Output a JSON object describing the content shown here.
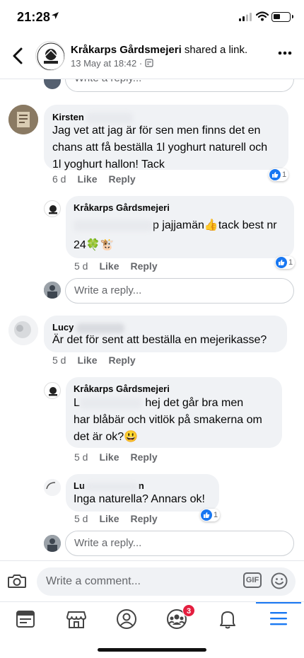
{
  "status_bar": {
    "time": "21:28"
  },
  "header": {
    "page_name": "Kråkarps Gårdsmejeri",
    "action": " shared a link.",
    "date": "13 May at 18:42 · "
  },
  "colors": {
    "accent": "#1877f2",
    "bubble": "#f0f2f5",
    "muted": "#65676b",
    "badge": "#e41e3f"
  },
  "top_reply_placeholder": "Write a reply...",
  "comments": [
    {
      "name": "Kirsten",
      "text_lines": [
        "Jag vet att jag är för sen men finns det en",
        "chans att få beställa 1l yoghurt naturell och",
        "1l yoghurt hallon! Tack"
      ],
      "time": "6 d",
      "like": "Like",
      "reply": "Reply",
      "reactions": "1"
    },
    {
      "name": "Kråkarps Gårdsmejeri",
      "text_lines": [
        "p jajjamän👍tack best nr",
        "24🍀🐮"
      ],
      "time": "5 d",
      "like": "Like",
      "reply": "Reply",
      "reactions": "1"
    },
    {
      "name": "Lucy",
      "text_lines": [
        "Är det för sent att beställa en mejerikasse?"
      ],
      "time": "5 d",
      "like": "Like",
      "reply": "Reply"
    },
    {
      "name": "Kråkarps Gårdsmejeri",
      "text_lines": [
        "hej det går bra men",
        "har blåbär och vitlök på smakerna om",
        "det är ok?😃"
      ],
      "first_prefix": "L",
      "time": "5 d",
      "like": "Like",
      "reply": "Reply"
    },
    {
      "name": "Lu",
      "name_suffix": "n",
      "text_lines": [
        "Inga naturella? Annars ok!"
      ],
      "time": "5 d",
      "like": "Like",
      "reply": "Reply",
      "reactions": "1"
    }
  ],
  "reply_placeholder_1": "Write a reply...",
  "reply_placeholder_2": "Write a reply...",
  "composer": {
    "placeholder": "Write a comment...",
    "gif": "GIF"
  },
  "tabbar": {
    "notifications_badge": "3"
  }
}
